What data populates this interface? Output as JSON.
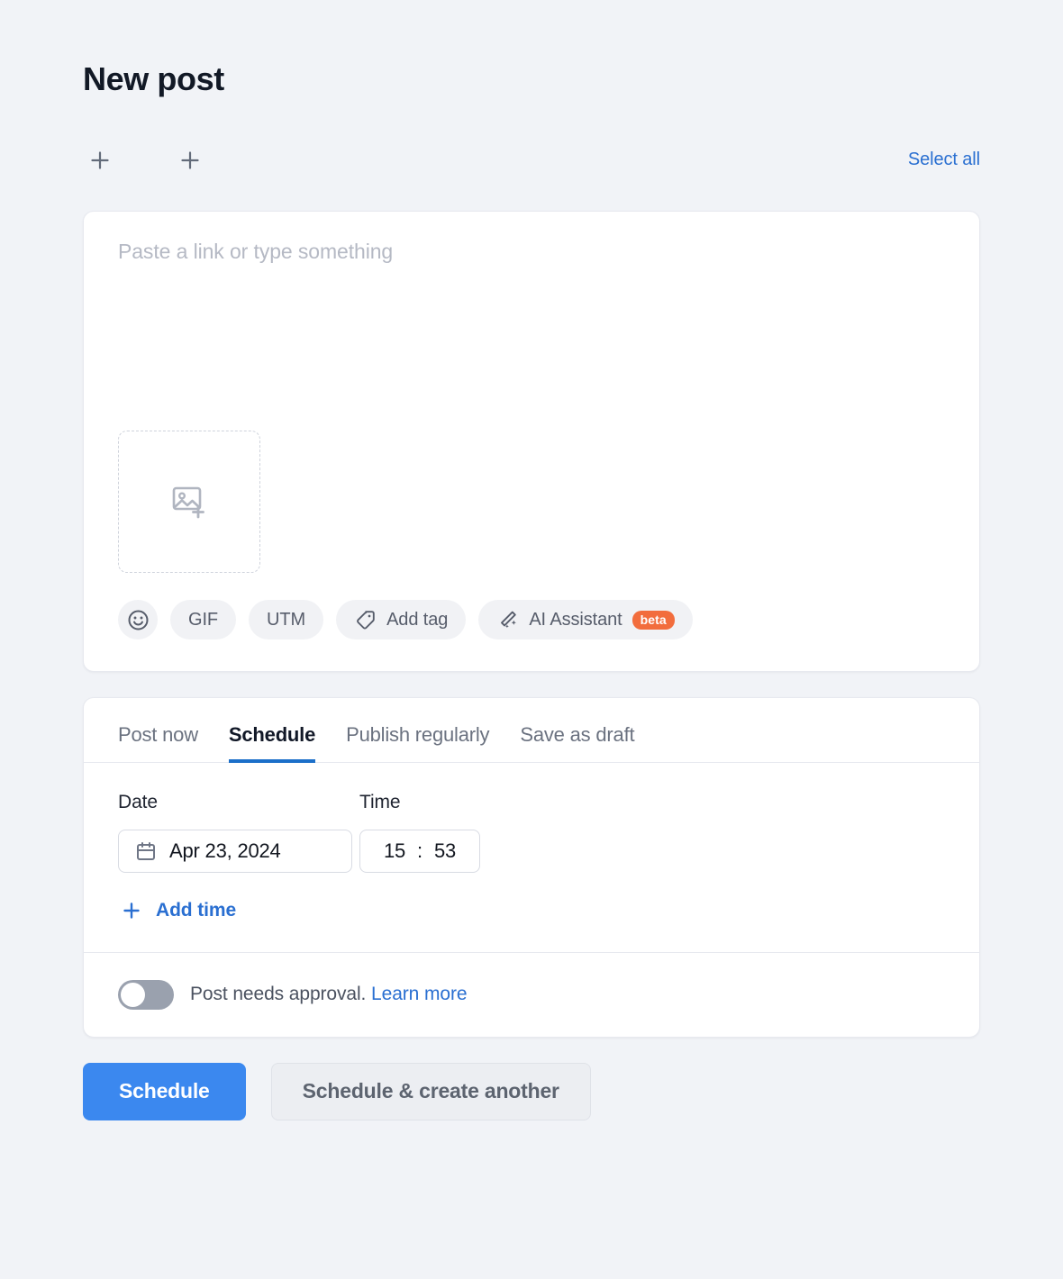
{
  "header": {
    "title": "New post"
  },
  "accounts": {
    "add_icons": [
      "plus-icon",
      "plus-icon"
    ],
    "select_all_label": "Select all"
  },
  "composer": {
    "placeholder": "Paste a link or type something",
    "media_drop_icon": "image-add-icon",
    "toolbar": [
      {
        "name": "emoji",
        "icon": "smiley-icon",
        "label": ""
      },
      {
        "name": "gif",
        "icon": "",
        "label": "GIF"
      },
      {
        "name": "utm",
        "icon": "",
        "label": "UTM"
      },
      {
        "name": "add-tag",
        "icon": "tag-icon",
        "label": "Add tag"
      },
      {
        "name": "ai-assistant",
        "icon": "magic-wand-icon",
        "label": "AI Assistant",
        "badge": "beta"
      }
    ]
  },
  "schedule": {
    "tabs": [
      {
        "label": "Post now",
        "active": false
      },
      {
        "label": "Schedule",
        "active": true
      },
      {
        "label": "Publish regularly",
        "active": false
      },
      {
        "label": "Save as draft",
        "active": false
      }
    ],
    "date_label": "Date",
    "time_label": "Time",
    "date_value": "Apr 23, 2024",
    "date_icon": "calendar-icon",
    "time_hours": "15",
    "time_separator": ":",
    "time_minutes": "53",
    "add_time_label": "Add time",
    "add_time_icon": "plus-icon",
    "approval_text": "Post needs approval.",
    "approval_link": "Learn more",
    "approval_enabled": false
  },
  "footer": {
    "primary_label": "Schedule",
    "secondary_label": "Schedule & create another"
  },
  "colors": {
    "accent_blue": "#2a6fd1",
    "primary_button": "#3b88ef",
    "tab_underline": "#1c6fc9",
    "beta_badge": "#f26d3d",
    "background": "#f1f3f7"
  }
}
